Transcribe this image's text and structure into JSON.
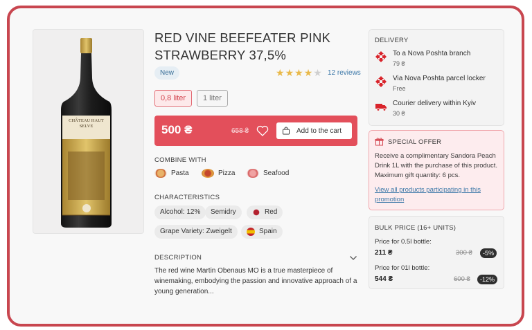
{
  "product": {
    "title": "RED VINE BEEFEATER PINK STRAWBERRY 37,5%",
    "badge": "New",
    "rating": 4,
    "rating_max": 5,
    "reviews": "12 reviews",
    "image_bottle_label": "CHÂTEAU HAUT SELVE"
  },
  "volumes": {
    "active": "0,8 liter",
    "inactive": "1 liter"
  },
  "price": {
    "current": "500 ₴",
    "old": "658 ₴",
    "add_to_cart": "Add to the cart"
  },
  "combine": {
    "heading": "COMBINE WITH",
    "items": [
      "Pasta",
      "Pizza",
      "Seafood"
    ]
  },
  "characteristics": {
    "heading": "CHARACTERISTICS",
    "chips": [
      "Alcohol: 12%",
      "Semidry",
      "Red",
      "Grape Variety: Zweigelt",
      "Spain"
    ]
  },
  "description": {
    "heading": "DESCRIPTION",
    "text": "The red wine Martin Obenaus MO is a true masterpiece of winemaking, embodying the passion and innovative approach of a young generation..."
  },
  "delivery": {
    "heading": "DELIVERY",
    "items": [
      {
        "title": "To a Nova Poshta branch",
        "sub": "79 ₴"
      },
      {
        "title": "Via Nova Poshta parcel locker",
        "sub": "Free"
      },
      {
        "title": "Courier delivery within Kyiv",
        "sub": "30 ₴"
      }
    ]
  },
  "offer": {
    "heading": "SPECIAL OFFER",
    "text": "Receive a complimentary Sandora Peach Drink 1L with the purchase of this product. Maximum gift quantity: 6 pcs.",
    "link": "View all products participating in this promotion"
  },
  "bulk": {
    "heading": "BULK PRICE (16+ UNITS)",
    "rows": [
      {
        "label": "Price for 0.5l bottle:",
        "price": "211 ₴",
        "old": "300 ₴",
        "discount": "-5%"
      },
      {
        "label": "Price for 01l bottle:",
        "price": "544 ₴",
        "old": "600 ₴",
        "discount": "-12%"
      }
    ]
  },
  "colors": {
    "accent": "#e34f5b",
    "frame": "#c8464f",
    "link": "#3c78a8",
    "star": "#e9b94a"
  }
}
